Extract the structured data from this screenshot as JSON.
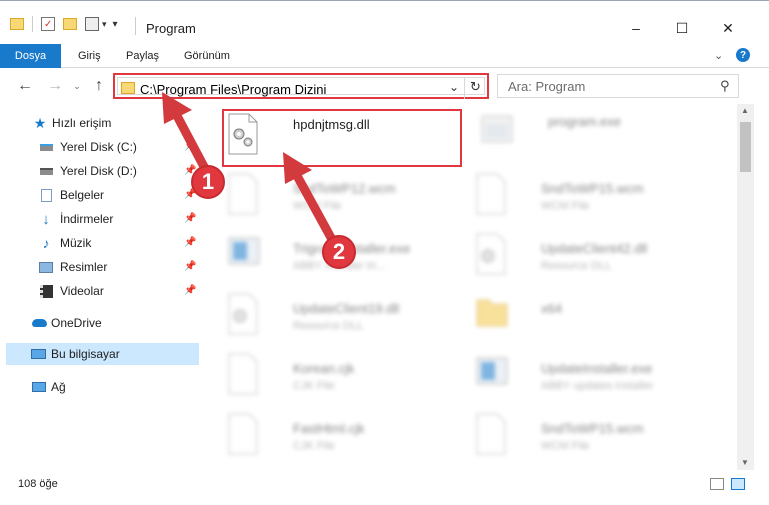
{
  "window": {
    "title": "Program",
    "minimize_glyph": "–",
    "maximize_glyph": "☐",
    "close_glyph": "✕"
  },
  "ribbon": {
    "tabs": [
      "Dosya",
      "Giriş",
      "Paylaş",
      "Görünüm"
    ]
  },
  "address_bar": {
    "path": "C:\\Program Files\\Program Dizini"
  },
  "search": {
    "placeholder": "Ara: Program"
  },
  "sidebar": {
    "items": [
      {
        "label": "Hızlı erişim",
        "icon": "star-icon",
        "pinned": false
      },
      {
        "label": "Yerel Disk (C:)",
        "icon": "drive-icon",
        "pinned": true
      },
      {
        "label": "Yerel Disk (D:)",
        "icon": "drive-icon",
        "pinned": true
      },
      {
        "label": "Belgeler",
        "icon": "documents-icon",
        "pinned": true
      },
      {
        "label": "İndirmeler",
        "icon": "download-icon",
        "pinned": true
      },
      {
        "label": "Müzik",
        "icon": "music-icon",
        "pinned": true
      },
      {
        "label": "Resimler",
        "icon": "pictures-icon",
        "pinned": true
      },
      {
        "label": "Videolar",
        "icon": "video-icon",
        "pinned": true
      },
      {
        "label": "OneDrive",
        "icon": "cloud-icon",
        "pinned": false
      },
      {
        "label": "Bu bilgisayar",
        "icon": "computer-icon",
        "pinned": false,
        "selected": true
      },
      {
        "label": "Ağ",
        "icon": "network-icon",
        "pinned": false
      }
    ]
  },
  "files": [
    {
      "name": "hpdnjtmsg.dll",
      "type": "",
      "icon": "dll-file-icon",
      "highlighted": true
    },
    {
      "name": "program.exe",
      "type": "",
      "icon": "exe-file-icon"
    },
    {
      "name": "SndToWP12.wcm",
      "type": "WCM File",
      "icon": "blank-file-icon"
    },
    {
      "name": "SndToWP15.wcm",
      "type": "WCM File",
      "icon": "blank-file-icon"
    },
    {
      "name": "TrigraphInstaller.exe",
      "type": "ABBY Installer tri...",
      "icon": "installer-icon"
    },
    {
      "name": "UpdateClient42.dll",
      "type": "Resource DLL",
      "icon": "dll-file-icon"
    },
    {
      "name": "UpdateClient19.dll",
      "type": "Resource DLL",
      "icon": "dll-file-icon"
    },
    {
      "name": "x64",
      "type": "",
      "icon": "folder-icon"
    },
    {
      "name": "Korean.cjk",
      "type": "CJK File",
      "icon": "blank-file-icon"
    },
    {
      "name": "UpdateInstaller.exe",
      "type": "ABBY updates installer",
      "icon": "installer-icon"
    },
    {
      "name": "FastHtml.cjk",
      "type": "CJK File",
      "icon": "blank-file-icon"
    },
    {
      "name": "SndToWP15.wcm",
      "type": "WCM File",
      "icon": "blank-file-icon"
    }
  ],
  "status": {
    "count_text": "108 öğe"
  },
  "callouts": [
    {
      "number": "1"
    },
    {
      "number": "2"
    }
  ],
  "colors": {
    "accent": "#1979ca",
    "callout_red": "#e0383e",
    "selected_bg": "#cce8ff"
  }
}
